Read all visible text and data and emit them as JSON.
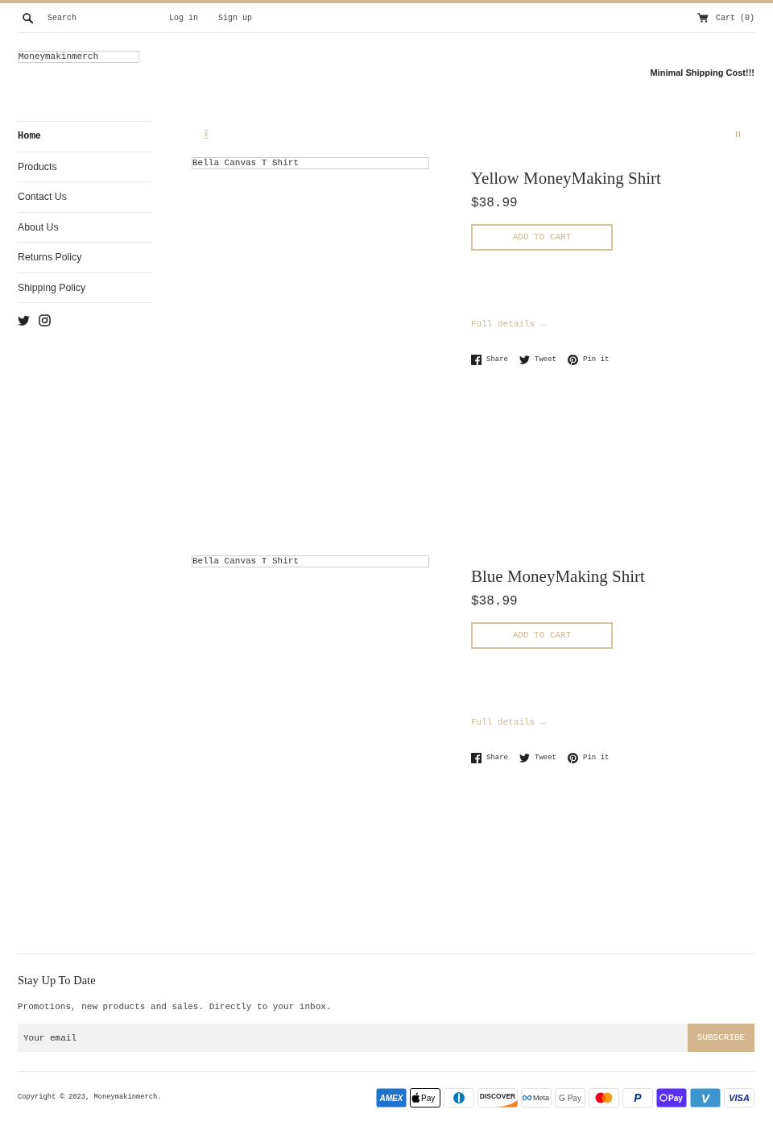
{
  "header": {
    "search": {
      "placeholder": "Search"
    },
    "account_links": [
      "Log in",
      "Sign up"
    ],
    "cart": "Cart (0)"
  },
  "logo": {
    "alt_text": "Moneymakinmerch"
  },
  "announcement": "Minimal Shipping Cost!!!",
  "sidebar": {
    "items": [
      {
        "label": "Home",
        "selected": true
      },
      {
        "label": "Products",
        "selected": false
      },
      {
        "label": "Contact Us",
        "selected": false
      },
      {
        "label": "About Us",
        "selected": false
      },
      {
        "label": "Returns Policy",
        "selected": false
      },
      {
        "label": "Shipping Policy",
        "selected": false
      }
    ],
    "social": [
      {
        "kind": "twitter"
      },
      {
        "kind": "instagram"
      }
    ]
  },
  "products": [
    {
      "image_alt": "Bella Canvas T Shirt",
      "title": "Yellow MoneyMaking Shirt",
      "price": "$38.99",
      "button": "ADD TO CART",
      "details_link": "Full details →",
      "share": [
        {
          "kind": "facebook",
          "label": "Share"
        },
        {
          "kind": "twitter",
          "label": "Tweet"
        },
        {
          "kind": "pinterest",
          "label": "Pin it"
        }
      ]
    },
    {
      "image_alt": "Bella Canvas T Shirt",
      "title": "Blue MoneyMaking Shirt",
      "price": "$38.99",
      "button": "ADD TO CART",
      "details_link": "Full details →",
      "share": [
        {
          "kind": "facebook",
          "label": "Share"
        },
        {
          "kind": "twitter",
          "label": "Tweet"
        },
        {
          "kind": "pinterest",
          "label": "Pin it"
        }
      ]
    }
  ],
  "newsletter": {
    "title": "Stay Up To Date",
    "text": "Promotions, new products and sales. Directly to your inbox.",
    "email": {
      "placeholder": "Your email"
    },
    "button": "SUBSCRIBE"
  },
  "footer": {
    "copyright": "Copyright © 2023, Moneymakinmerch.",
    "payment_icons": [
      {
        "kind": "amex",
        "text": "AMEX"
      },
      {
        "kind": "applepay",
        "text": "Pay"
      },
      {
        "kind": "diners"
      },
      {
        "kind": "discover",
        "text": "DISCOVER"
      },
      {
        "kind": "metapay",
        "text": "Meta"
      },
      {
        "kind": "googlepay",
        "text": "G Pay"
      },
      {
        "kind": "mastercard"
      },
      {
        "kind": "paypal",
        "text": "P"
      },
      {
        "kind": "shoppay",
        "text": "Pay"
      },
      {
        "kind": "venmo",
        "text": "V"
      },
      {
        "kind": "visa",
        "text": "VISA"
      }
    ]
  }
}
